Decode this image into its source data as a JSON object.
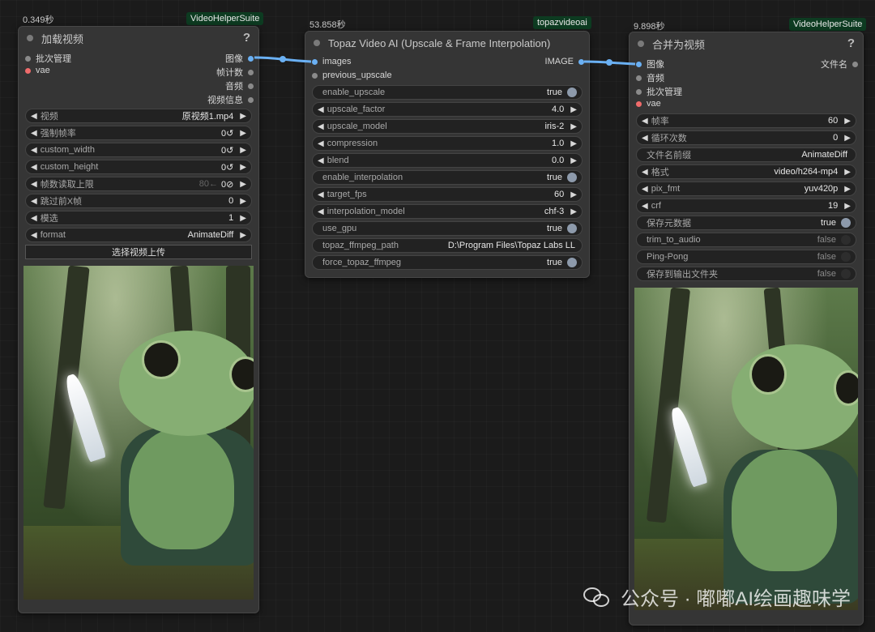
{
  "nodes": {
    "load": {
      "time": "0.349秒",
      "badge": "VideoHelperSuite",
      "title": "加载视频",
      "help": "?",
      "inputs": [
        "批次管理",
        "vae"
      ],
      "outputs": [
        "图像",
        "帧计数",
        "音频",
        "视频信息"
      ],
      "widgets": [
        {
          "label": "视频",
          "value": "原视频1.mp4"
        },
        {
          "label": "强制帧率",
          "value": "0↺"
        },
        {
          "label": "custom_width",
          "value": "0↺"
        },
        {
          "label": "custom_height",
          "value": "0↺"
        },
        {
          "label": "帧数读取上限",
          "hint": "80←",
          "value": "0⊘"
        },
        {
          "label": "跳过前X帧",
          "value": "0"
        },
        {
          "label": "模选",
          "value": "1"
        },
        {
          "label": "format",
          "value": "AnimateDiff"
        }
      ],
      "button": "选择视频上传"
    },
    "topaz": {
      "time": "53.858秒",
      "badge": "topazvideoai",
      "title": "Topaz Video AI (Upscale & Frame Interpolation)",
      "inputs": [
        "images",
        "previous_upscale"
      ],
      "outputs": [
        "IMAGE"
      ],
      "widgets": [
        {
          "label": "enable_upscale",
          "value": "true",
          "kind": "toggle"
        },
        {
          "label": "upscale_factor",
          "value": "4.0",
          "kind": "combo"
        },
        {
          "label": "upscale_model",
          "value": "iris-2",
          "kind": "combo"
        },
        {
          "label": "compression",
          "value": "1.0",
          "kind": "combo"
        },
        {
          "label": "blend",
          "value": "0.0",
          "kind": "combo"
        },
        {
          "label": "enable_interpolation",
          "value": "true",
          "kind": "toggle"
        },
        {
          "label": "target_fps",
          "value": "60",
          "kind": "combo"
        },
        {
          "label": "interpolation_model",
          "value": "chf-3",
          "kind": "combo"
        },
        {
          "label": "use_gpu",
          "value": "true",
          "kind": "toggle"
        },
        {
          "label": "topaz_ffmpeg_path",
          "value": "D:\\Program Files\\Topaz Labs LL",
          "kind": "text"
        },
        {
          "label": "force_topaz_ffmpeg",
          "value": "true",
          "kind": "toggle"
        }
      ]
    },
    "combine": {
      "time": "9.898秒",
      "badge": "VideoHelperSuite",
      "title": "合并为视频",
      "help": "?",
      "inputs": [
        "图像",
        "音频",
        "批次管理",
        "vae"
      ],
      "outputs": [
        "文件名"
      ],
      "widgets": [
        {
          "label": "帧率",
          "value": "60",
          "kind": "combo"
        },
        {
          "label": "循环次数",
          "value": "0",
          "kind": "combo"
        },
        {
          "label": "文件名前缀",
          "value": "AnimateDiff",
          "kind": "text"
        },
        {
          "label": "格式",
          "value": "video/h264-mp4",
          "kind": "combo"
        },
        {
          "label": "pix_fmt",
          "value": "yuv420p",
          "kind": "combo"
        },
        {
          "label": "crf",
          "value": "19",
          "kind": "combo"
        },
        {
          "label": "保存元数据",
          "value": "true",
          "kind": "toggle"
        },
        {
          "label": "trim_to_audio",
          "value": "false",
          "kind": "toggle-off"
        },
        {
          "label": "Ping-Pong",
          "value": "false",
          "kind": "toggle-off"
        },
        {
          "label": "保存到输出文件夹",
          "value": "false",
          "kind": "toggle-off"
        }
      ]
    }
  },
  "watermark": "公众号 · 嘟嘟AI绘画趣味学",
  "colors": {
    "link": "#6ab0f3",
    "badge_bg": "#0d3b21",
    "node_bg": "#353535",
    "canvas_bg": "#1b1b1b"
  }
}
